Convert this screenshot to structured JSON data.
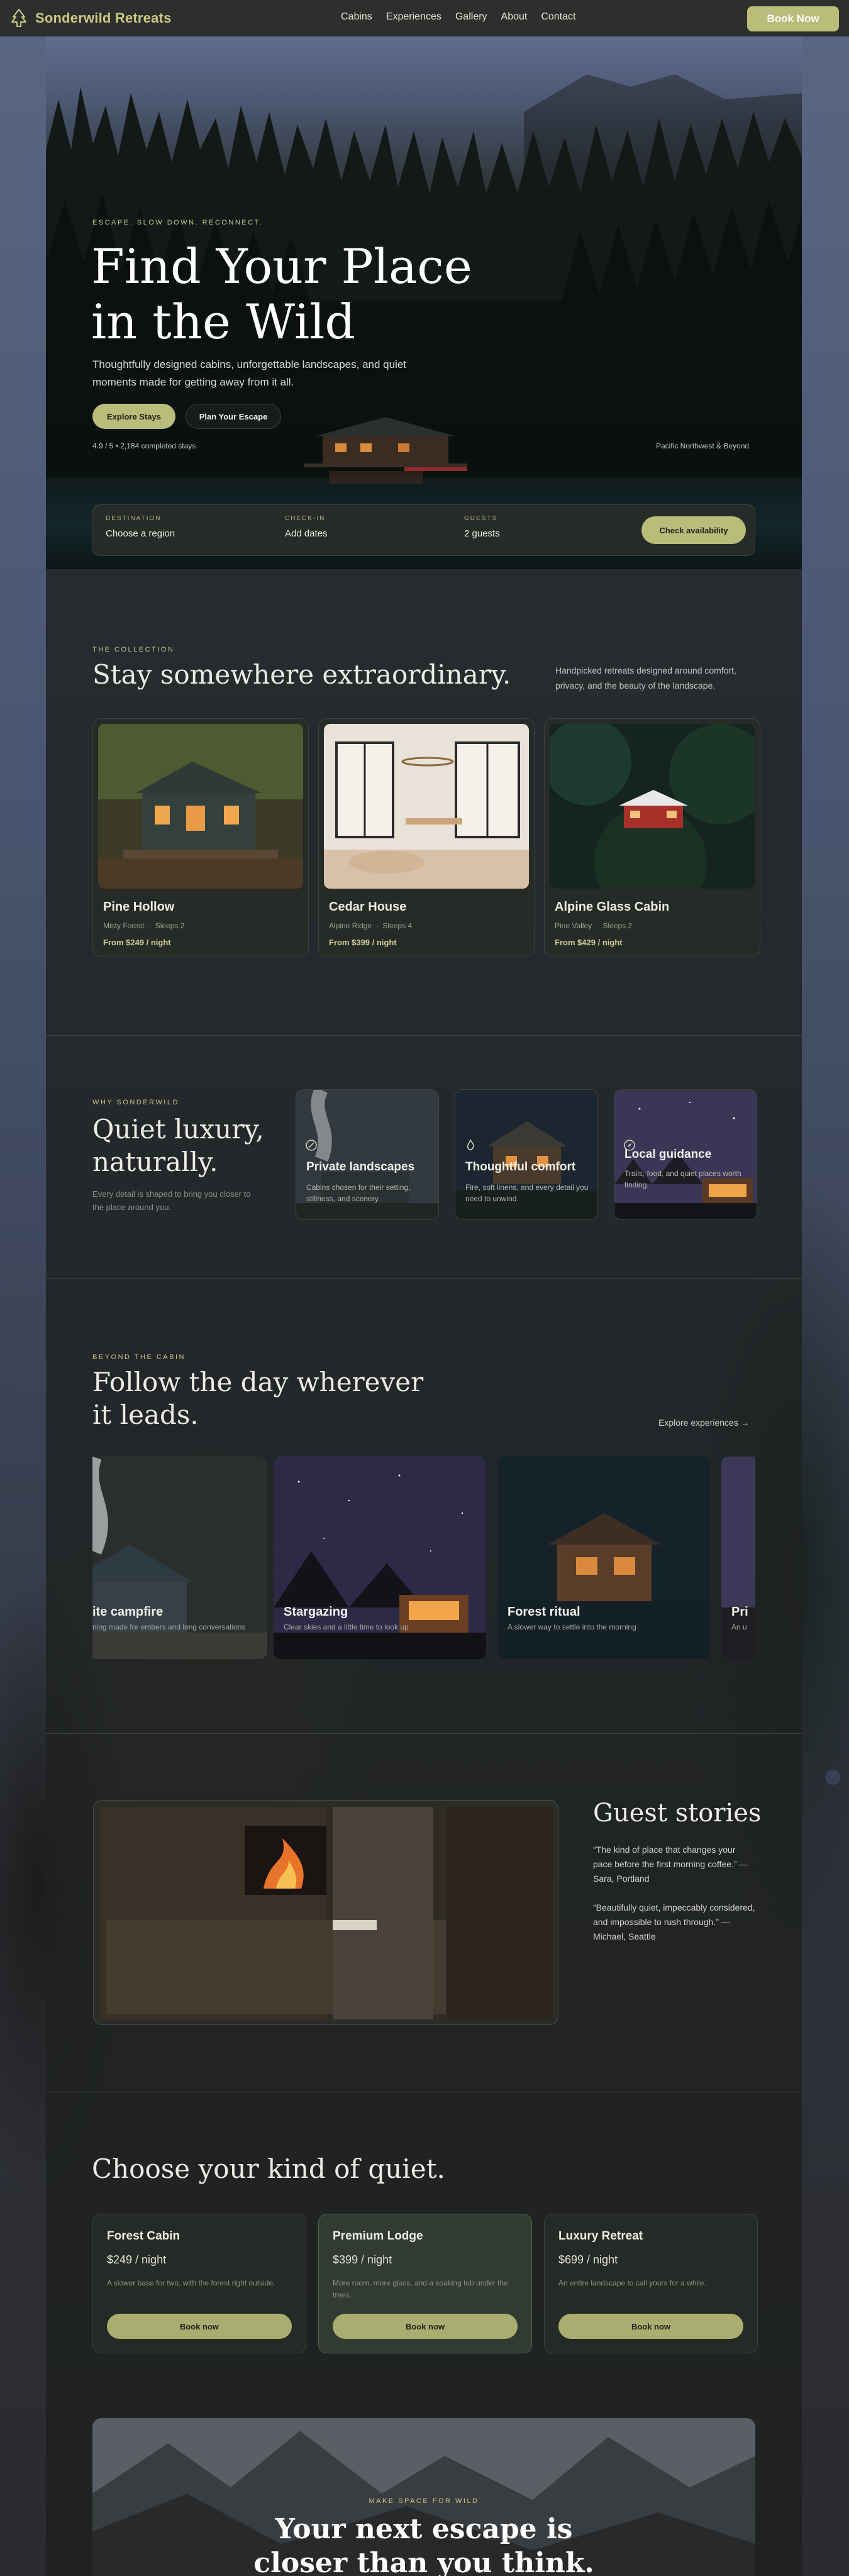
{
  "brand": {
    "name": "Sonderwild Retreats",
    "logo_icon": "pine-tree-icon",
    "accent": "#b9bd7a"
  },
  "nav": {
    "links": [
      "Cabins",
      "Experiences",
      "Gallery",
      "About",
      "Contact"
    ],
    "cta": "Book Now"
  },
  "hero": {
    "eyebrow": "ESCAPE. SLOW DOWN. RECONNECT.",
    "title_line1": "Find Your Place",
    "title_line2": "in the Wild",
    "subtitle": "Thoughtfully designed cabins, unforgettable landscapes, and quiet moments made for getting away from it all.",
    "primary_cta": "Explore Stays",
    "secondary_cta": "Plan Your Escape",
    "stats": "4.9 / 5  •  2,184 completed stays",
    "region": "Pacific Northwest & Beyond"
  },
  "search": {
    "destination": {
      "label": "DESTINATION",
      "value": "Choose a region"
    },
    "checkin": {
      "label": "CHECK-IN",
      "value": "Add dates"
    },
    "guests": {
      "label": "GUESTS",
      "value": "2 guests"
    },
    "button": "Check availability"
  },
  "collection": {
    "eyebrow": "THE COLLECTION",
    "title": "Stay somewhere extraordinary.",
    "description": "Handpicked retreats designed around comfort, privacy, and the beauty of the landscape.",
    "cabins": [
      {
        "name": "Pine Hollow",
        "location": "Misty Forest",
        "sleeps": "Sleeps 2",
        "price": "From $249 / night"
      },
      {
        "name": "Cedar House",
        "location": "Alpine Ridge",
        "sleeps": "Sleeps 4",
        "price": "From $399 / night"
      },
      {
        "name": "Alpine Glass Cabin",
        "location": "Pine Valley",
        "sleeps": "Sleeps 2",
        "price": "From $429 / night"
      }
    ]
  },
  "why": {
    "eyebrow": "WHY SONDERWILD",
    "title": "Quiet luxury, naturally.",
    "description": "Every detail is shaped to bring you closer to the place around you.",
    "features": [
      {
        "icon": "leaf-icon",
        "title": "Private landscapes",
        "desc": "Cabins chosen for their setting, stillness, and scenery."
      },
      {
        "icon": "flame-icon",
        "title": "Thoughtful comfort",
        "desc": "Fire, soft linens, and every detail you need to unwind."
      },
      {
        "icon": "compass-icon",
        "title": "Local guidance",
        "desc": "Trails, food, and quiet places worth finding."
      }
    ]
  },
  "experiences": {
    "eyebrow": "BEYOND THE CABIN",
    "title": "Follow the day wherever it leads.",
    "link": "Explore experiences →",
    "items": [
      {
        "name": "Lakeside campfire",
        "visible_name": "ite campfire",
        "desc": "Evening made for embers and long conversations",
        "visible_desc": "ning made for embers and long conversations"
      },
      {
        "name": "Stargazing",
        "desc": "Clear skies and a little time to look up"
      },
      {
        "name": "Forest ritual",
        "desc": "A slower way to settle into the morning"
      },
      {
        "name": "Pri",
        "desc": "An u"
      }
    ]
  },
  "stories": {
    "title": "Guest stories",
    "quotes": [
      "“The kind of place that changes your pace before the first morning coffee.” — Sara, Portland",
      "“Beautifully quiet, impeccably considered, and impossible to rush through.” — Michael, Seattle"
    ]
  },
  "pricing": {
    "title": "Choose your kind of quiet.",
    "plans": [
      {
        "name": "Forest Cabin",
        "price": "$249 / night",
        "desc": "A slower base for two, with the forest right outside.",
        "button": "Book now"
      },
      {
        "name": "Premium Lodge",
        "price": "$399 / night",
        "desc": "More room, more glass, and a soaking tub under the trees.",
        "button": "Book now"
      },
      {
        "name": "Luxury Retreat",
        "price": "$699 / night",
        "desc": "An entire landscape to call yours for a while.",
        "button": "Book now"
      }
    ]
  },
  "cta": {
    "eyebrow": "MAKE SPACE FOR WILD",
    "title_line1": "Your next escape is",
    "title_line2": "closer than you think."
  }
}
